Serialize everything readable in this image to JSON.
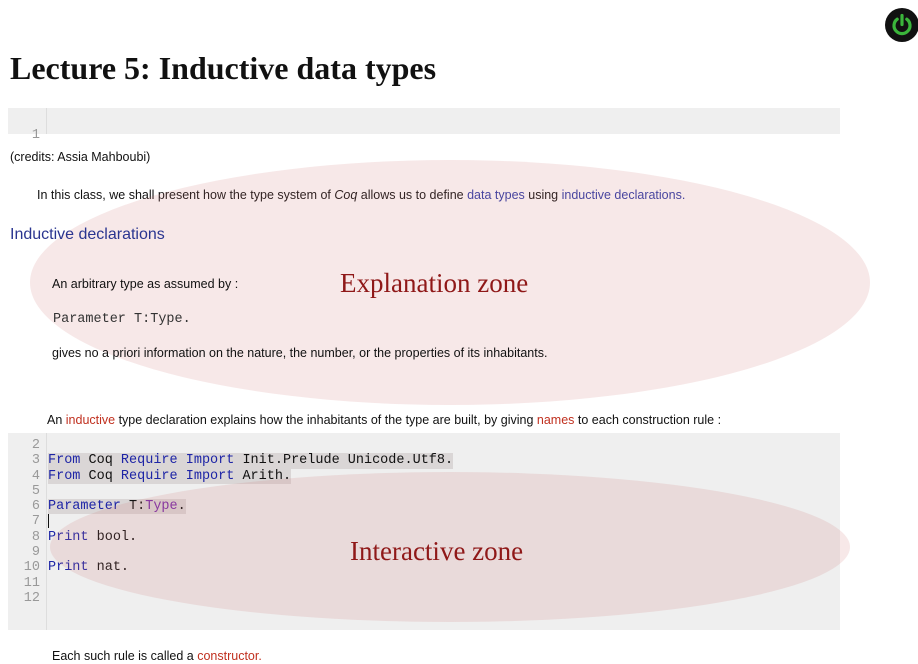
{
  "page": {
    "title": "Lecture 5: Inductive data types",
    "credits": "(credits: Assia Mahboubi)",
    "intro": {
      "before": "In this class, we shall present how the type system of ",
      "coq": "Coq",
      "middle": " allows us to define ",
      "link1": "data types",
      "between": " using ",
      "link2": "inductive declarations."
    },
    "section_heading": "Inductive declarations",
    "para1": "An arbitrary type as assumed by :",
    "param_code": "Parameter T:Type.",
    "para2": "gives no a priori information on the nature, the number, or the properties of its inhabitants.",
    "para3": {
      "before": "An ",
      "w1": "inductive",
      "mid1": " type declaration explains how the inhabitants of the type are built, by giving ",
      "w2": "names",
      "after": " to each construction rule :"
    },
    "para4": {
      "before": "Each such rule is called a ",
      "w1": "constructor."
    }
  },
  "code_block_1": {
    "line_numbers": [
      "1"
    ]
  },
  "code_block_2": {
    "line_numbers": [
      "2",
      "3",
      "4",
      "5",
      "6",
      "7",
      "8",
      "9",
      "10",
      "11",
      "12"
    ],
    "line3": {
      "kw1": "From",
      "t1": " Coq ",
      "kw2": "Require",
      "t2": " ",
      "kw3": "Import",
      "t3": " Init.Prelude Unicode.Utf8."
    },
    "line4": {
      "kw1": "From",
      "t1": " Coq ",
      "kw2": "Require",
      "t2": " ",
      "kw3": "Import",
      "t3": " Arith."
    },
    "line6": {
      "kw1": "Parameter",
      "t1": " T:",
      "ty": "Type",
      "t2": "."
    },
    "line8": {
      "kw1": "Print",
      "t1": " bool."
    },
    "line10": {
      "kw1": "Print",
      "t1": " nat."
    }
  },
  "annotations": {
    "explanation_zone": "Explanation zone",
    "interactive_zone": "Interactive zone"
  },
  "colors": {
    "keyword": "#1d24a6",
    "type": "#7a2ba8",
    "link_blue": "#2e3ca8",
    "link_red": "#c0301f",
    "annotation": "#8f1818",
    "power_icon": "#3bb53b"
  },
  "icons": {
    "top_right": "power-icon"
  }
}
